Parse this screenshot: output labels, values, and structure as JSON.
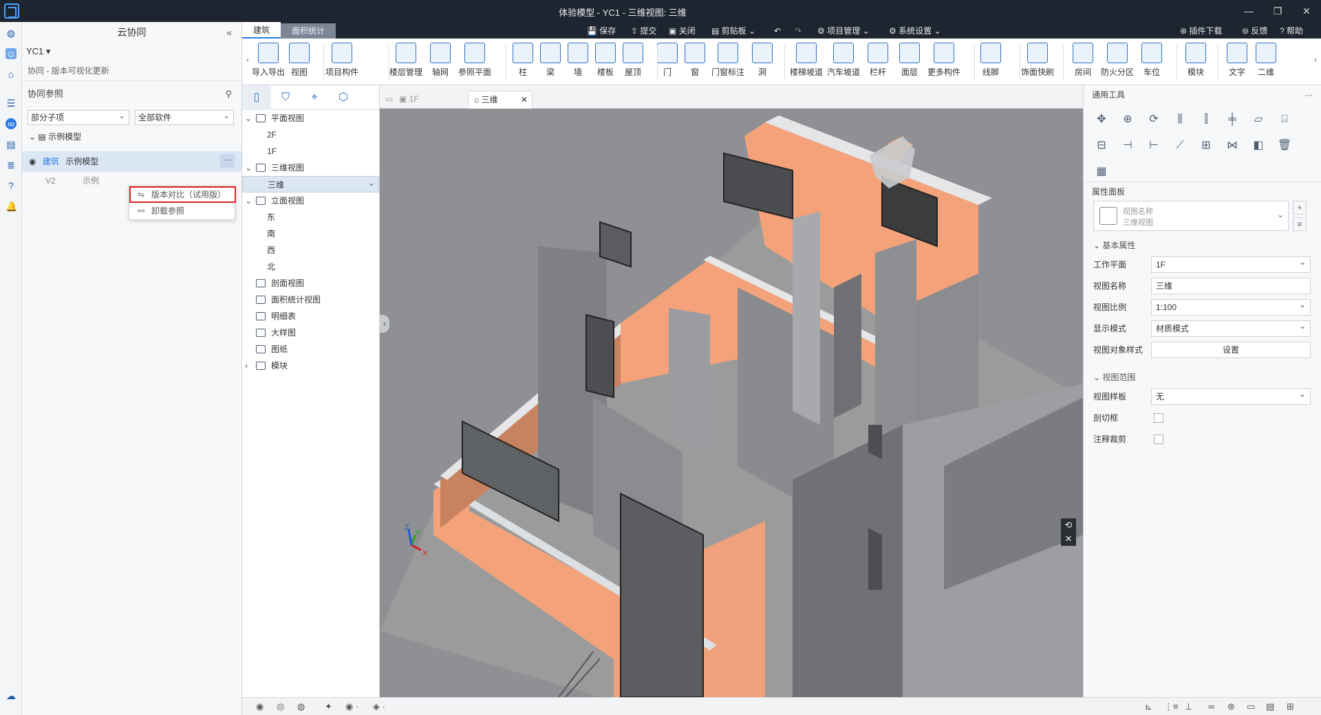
{
  "window": {
    "title": "体验模型 - YC1 - 三维视图: 三维",
    "buttons": [
      "—",
      "❐",
      "✕"
    ]
  },
  "quick_access": {
    "save": "保存",
    "submit": "提交",
    "close": "关闭",
    "clipboard": "剪贴板",
    "project_mgmt": "项目管理",
    "system_settings": "系统设置",
    "plugin_download": "插件下载",
    "feedback": "反馈",
    "help": "帮助"
  },
  "ribbon_tabs": [
    "建筑",
    "面积统计"
  ],
  "tools": [
    {
      "label": "导入导出"
    },
    {
      "label": "视图"
    },
    {
      "label": "项目构件"
    },
    {
      "label": "楼层管理"
    },
    {
      "label": "轴网"
    },
    {
      "label": "参照平面"
    },
    {
      "label": "柱"
    },
    {
      "label": "梁"
    },
    {
      "label": "墙"
    },
    {
      "label": "楼板"
    },
    {
      "label": "屋顶"
    },
    {
      "label": "门"
    },
    {
      "label": "窗"
    },
    {
      "label": "门窗标注"
    },
    {
      "label": "洞"
    },
    {
      "label": "楼梯坡道"
    },
    {
      "label": "汽车坡道"
    },
    {
      "label": "栏杆"
    },
    {
      "label": "面层"
    },
    {
      "label": "更多构件"
    },
    {
      "label": "线脚"
    },
    {
      "label": "饰面快刷"
    },
    {
      "label": "房间"
    },
    {
      "label": "防火分区"
    },
    {
      "label": "车位"
    },
    {
      "label": "模块"
    },
    {
      "label": "文字"
    },
    {
      "label": "二维"
    }
  ],
  "cloud": {
    "title": "云协同",
    "project": "YC1",
    "crumb": "协同 - 版本可视化更新",
    "section": "协同参照",
    "filter1": "部分子项",
    "filter2": "全部软件",
    "group": "示例模型",
    "item_tag": "建筑",
    "item_name": "示例模型",
    "item_version": "V2",
    "item_sub": "示例",
    "more": "···"
  },
  "context_menu": {
    "items": [
      {
        "label": "版本对比（试用版）"
      },
      {
        "label": "卸载参照"
      }
    ]
  },
  "browser": {
    "nodes": [
      {
        "label": "平面视图",
        "level": 0,
        "tw": "⌄"
      },
      {
        "label": "2F",
        "level": 1
      },
      {
        "label": "1F",
        "level": 1
      },
      {
        "label": "三维视图",
        "level": 0,
        "tw": "⌄"
      },
      {
        "label": "三维",
        "level": 1,
        "selected": true
      },
      {
        "label": "立面视图",
        "level": 0,
        "tw": "⌄"
      },
      {
        "label": "东",
        "level": 1
      },
      {
        "label": "南",
        "level": 1
      },
      {
        "label": "西",
        "level": 1
      },
      {
        "label": "北",
        "level": 1
      },
      {
        "label": "剖面视图",
        "level": 0
      },
      {
        "label": "面积统计视图",
        "level": 0
      },
      {
        "label": "明细表",
        "level": 0
      },
      {
        "label": "大样图",
        "level": 0
      },
      {
        "label": "图纸",
        "level": 0
      },
      {
        "label": "模块",
        "level": 0,
        "tw": "›"
      }
    ]
  },
  "view_tabs": {
    "tab1": "1F",
    "tab2": "三维"
  },
  "props": {
    "general_tools": "通用工具",
    "panel": "属性面板",
    "view_name_label": "视图名称",
    "view_name_type": "三维视图",
    "basic": "基本属性",
    "range": "视图范围",
    "rows": [
      {
        "label": "工作平面",
        "value": "1F",
        "type": "dd"
      },
      {
        "label": "视图名称",
        "value": "三维",
        "type": "text"
      },
      {
        "label": "视图比例",
        "value": "1:100",
        "type": "dd"
      },
      {
        "label": "显示模式",
        "value": "材质模式",
        "type": "dd"
      },
      {
        "label": "视图对象样式",
        "value": "设置",
        "type": "btn"
      }
    ],
    "rows2": [
      {
        "label": "视图样板",
        "value": "无",
        "type": "dd"
      },
      {
        "label": "剖切框",
        "type": "cb"
      },
      {
        "label": "注释裁剪",
        "type": "cb"
      }
    ]
  },
  "axes": {
    "x": "X",
    "y": "Y",
    "z": "Z"
  },
  "colors": {
    "accent": "#2b78e4",
    "wall_orange": "#f4a27a",
    "floor": "#9a9a9a",
    "titlebar": "#1d2530"
  }
}
